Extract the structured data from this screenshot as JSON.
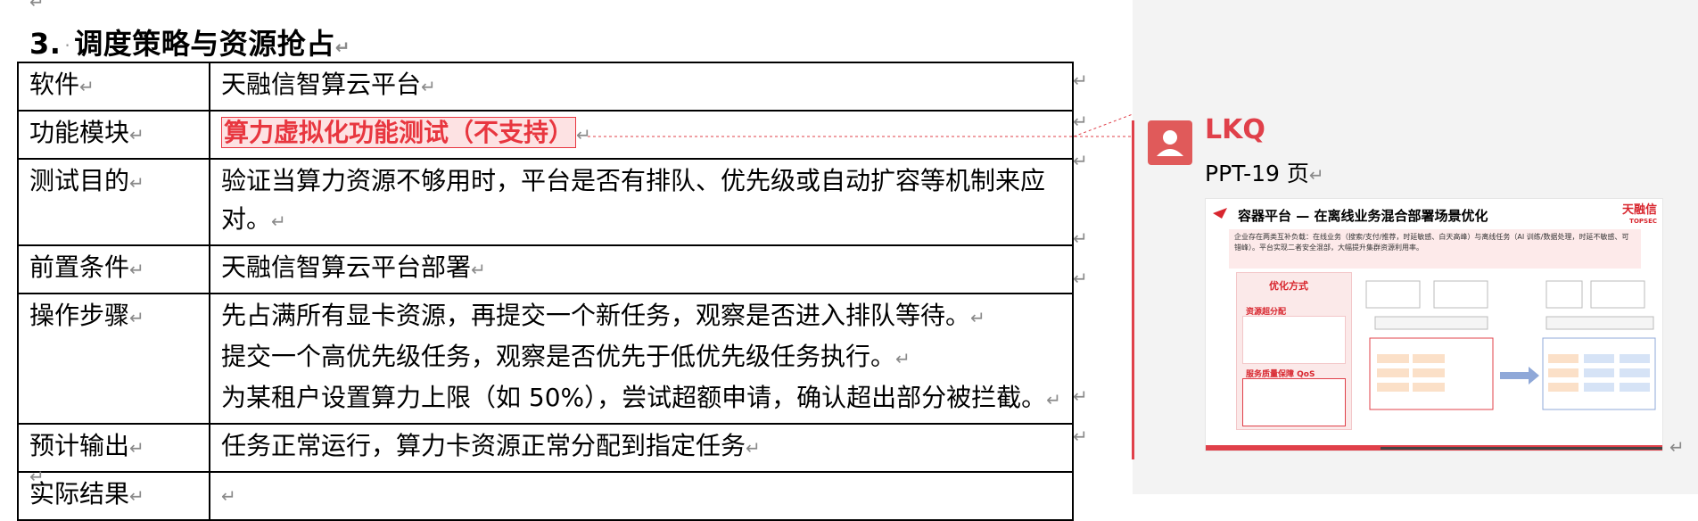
{
  "document": {
    "heading": "3. 调度策略与资源抢占",
    "heading_number": "3.",
    "heading_text": "调度策略与资源抢占",
    "paragraph_mark": "↵",
    "rows": [
      {
        "label": "软件",
        "lines": [
          "天融信智算云平台"
        ]
      },
      {
        "label": "功能模块",
        "lines": [
          "算力虚拟化功能测试（不支持）"
        ],
        "highlighted": true
      },
      {
        "label": "测试目的",
        "lines": [
          "验证当算力资源不够用时，平台是否有排队、优先级或自动扩容等机制来应对。"
        ]
      },
      {
        "label": "前置条件",
        "lines": [
          "天融信智算云平台部署"
        ]
      },
      {
        "label": "操作步骤",
        "lines": [
          "先占满所有显卡资源，再提交一个新任务，观察是否进入排队等待。",
          "提交一个高优先级任务，观察是否优先于低优先级任务执行。",
          "为某租户设置算力上限（如 50%），尝试超额申请，确认超出部分被拦截。"
        ]
      },
      {
        "label": "预计输出",
        "lines": [
          "任务正常运行，算力卡资源正常分配到指定任务"
        ]
      },
      {
        "label": "实际结果",
        "lines": [
          ""
        ]
      }
    ]
  },
  "comment": {
    "author": "LKQ",
    "text": "PPT-19 页",
    "slide": {
      "title": "容器平台 — 在离线业务混合部署场景优化",
      "logo": "天融信",
      "logo_sub": "TOPSEC",
      "intro": "企业存在两类互补负载：在线业务（搜索/支付/推荐，时延敏感、白天高峰）与离线任务（AI 训练/数据处理，时延不敏感、可错峰）。平台实现二者安全混部，大幅提升集群资源利用率。",
      "left_title": "优化方式",
      "left_item1": "资源超分配",
      "left_item2": "服务质量保障 QoS"
    }
  },
  "colors": {
    "accent": "#e0404a",
    "highlight_text": "#e8363f",
    "pane_bg": "#f3f3f3"
  }
}
